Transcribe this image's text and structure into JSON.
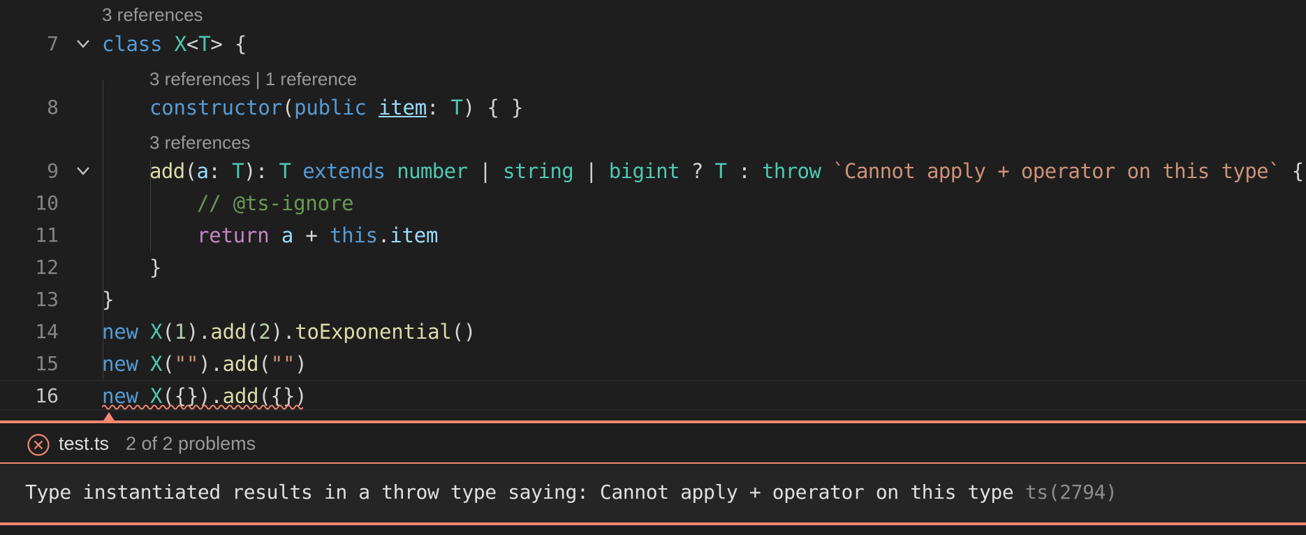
{
  "editor": {
    "lenses": {
      "l7": "3 references",
      "l8": "3 references | 1 reference",
      "l9": "3 references"
    },
    "lines": [
      {
        "n": "7"
      },
      {
        "n": "8"
      },
      {
        "n": "9"
      },
      {
        "n": "10"
      },
      {
        "n": "11"
      },
      {
        "n": "12"
      },
      {
        "n": "13"
      },
      {
        "n": "14"
      },
      {
        "n": "15"
      },
      {
        "n": "16"
      }
    ],
    "t": {
      "l7_class": "class",
      "l7_X": "X",
      "l7_lt": "<",
      "l7_T": "T",
      "l7_gt": "> {",
      "l8_ctor": "constructor",
      "l8_p1": "(",
      "l8_public": "public",
      "l8_item": "item",
      "l8_colon": ": ",
      "l8_T": "T",
      "l8_rest": ") { }",
      "l9_add": "add",
      "l9_p1": "(",
      "l9_a": "a",
      "l9_colon": ": ",
      "l9_T1": "T",
      "l9_p2": "): ",
      "l9_T2": "T",
      "l9_extends": "extends",
      "l9_number": "number",
      "l9_bar1": " | ",
      "l9_string": "string",
      "l9_bar2": " | ",
      "l9_bigint": "bigint",
      "l9_q": " ? ",
      "l9_T3": "T",
      "l9_c": " : ",
      "l9_throw": "throw",
      "l9_msg": "`Cannot apply + operator on this type`",
      "l9_brace": " {",
      "l10_comment": "// @ts-ignore",
      "l11_return": "return",
      "l11_a": "a",
      "l11_plus": " + ",
      "l11_this": "this",
      "l11_dot": ".",
      "l11_item": "item",
      "l12_brace": "}",
      "l13_brace": "}",
      "l14_new": "new",
      "l14_X": "X",
      "l14_p1": "(",
      "l14_1": "1",
      "l14_p2": ").",
      "l14_add": "add",
      "l14_p3": "(",
      "l14_2": "2",
      "l14_p4": ").",
      "l14_toexp": "toExponential",
      "l14_p5": "()",
      "l15_new": "new",
      "l15_X": "X",
      "l15_p1": "(",
      "l15_s1": "\"\"",
      "l15_p2": ").",
      "l15_add": "add",
      "l15_p3": "(",
      "l15_s2": "\"\"",
      "l15_p4": ")",
      "l16_new": "new",
      "l16_X": "X",
      "l16_p1": "({}).",
      "l16_add": "add",
      "l16_p2": "({})"
    }
  },
  "problems": {
    "file": "test.ts",
    "count": "2 of 2 problems",
    "message": "Type instantiated results in a throw type saying: Cannot apply + operator on this type",
    "code": "ts(2794)"
  },
  "colors": {
    "error": "#f48771",
    "keyword": "#569cd6",
    "type": "#4ec9b0",
    "function": "#dcdcaa",
    "variable": "#9cdcfe",
    "string": "#ce9178",
    "number": "#b5cea8",
    "comment": "#6a9955",
    "control": "#c586c0"
  },
  "icons": [
    "chevron-down-icon",
    "error-circle-icon"
  ]
}
